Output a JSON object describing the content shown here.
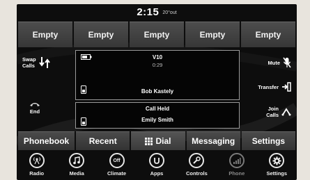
{
  "status": {
    "time": "2:15",
    "outside_temp": "20°out"
  },
  "favorites": [
    "Empty",
    "Empty",
    "Empty",
    "Empty",
    "Empty"
  ],
  "left_controls": {
    "swap_calls": "Swap\nCalls",
    "end": "End"
  },
  "right_controls": {
    "mute": "Mute",
    "transfer": "Transfer",
    "join_calls": "Join\nCalls"
  },
  "active_call": {
    "device": "V10",
    "duration": "0:29",
    "contact": "Bob Kastely"
  },
  "held_call": {
    "status": "Call Held",
    "contact": "Emily Smith"
  },
  "menu": {
    "phonebook": "Phonebook",
    "recent": "Recent",
    "dial": "Dial",
    "messaging": "Messaging",
    "settings": "Settings"
  },
  "apps": [
    {
      "label": "Radio",
      "icon": "radio-icon"
    },
    {
      "label": "Media",
      "icon": "music-note-icon"
    },
    {
      "label": "Climate",
      "icon": "climate-off-icon",
      "glyph": "Off"
    },
    {
      "label": "Apps",
      "icon": "apps-icon"
    },
    {
      "label": "Controls",
      "icon": "wrench-icon"
    },
    {
      "label": "Phone",
      "icon": "phone-signal-icon"
    },
    {
      "label": "Settings",
      "icon": "gear-icon"
    }
  ]
}
